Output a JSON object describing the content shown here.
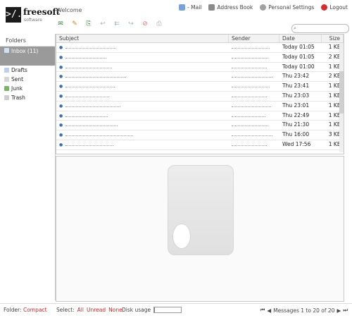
{
  "header": {
    "logo_mark": ">/.",
    "brand": "freesoft",
    "brand_sub": "software",
    "welcome": "Welcome",
    "nav": [
      {
        "label": "- Mail",
        "icon": "mail-icon"
      },
      {
        "label": "Address Book",
        "icon": "address-book-icon"
      },
      {
        "label": "Personal Settings",
        "icon": "settings-icon"
      },
      {
        "label": "Logout",
        "icon": "logout-icon"
      }
    ],
    "toolbar": [
      {
        "icon": "compose-icon",
        "glyph": "✉"
      },
      {
        "icon": "edit-icon",
        "glyph": "✎"
      },
      {
        "icon": "attachment-icon",
        "glyph": "⎘"
      },
      {
        "icon": "reply-icon",
        "glyph": "↩"
      },
      {
        "icon": "reply-all-icon",
        "glyph": "⇇"
      },
      {
        "icon": "forward-icon",
        "glyph": "↪"
      },
      {
        "icon": "delete-icon",
        "glyph": "⊘"
      },
      {
        "icon": "print-icon",
        "glyph": "⎙"
      }
    ],
    "search_placeholder": ""
  },
  "folders": {
    "heading": "Folders",
    "items": [
      {
        "label": "Inbox (11)",
        "icon": "inbox-icon",
        "selected": true
      },
      {
        "label": "Drafts",
        "icon": "drafts-icon"
      },
      {
        "label": "Sent",
        "icon": "sent-icon"
      },
      {
        "label": "Junk",
        "icon": "junk-icon"
      },
      {
        "label": "Trash",
        "icon": "trash-icon"
      }
    ]
  },
  "messages": {
    "columns": [
      "Subject",
      "Sender",
      "Date",
      "Size"
    ],
    "rows": [
      {
        "date": "Today 01:05",
        "size": "1 KB"
      },
      {
        "date": "Today 01:05",
        "size": "2 KB"
      },
      {
        "date": "Today 01:00",
        "size": "1 KB"
      },
      {
        "date": "Thu 23:42",
        "size": "2 KB"
      },
      {
        "date": "Thu 23:41",
        "size": "1 KB"
      },
      {
        "date": "Thu 23:03",
        "size": "1 KB"
      },
      {
        "date": "Thu 23:01",
        "size": "1 KB"
      },
      {
        "date": "Thu 22:49",
        "size": "1 KB"
      },
      {
        "date": "Thu 21:30",
        "size": "1 KB"
      },
      {
        "date": "Thu 16:00",
        "size": "3 KB"
      },
      {
        "date": "Wed 17:56",
        "size": "1 KB"
      }
    ]
  },
  "footer": {
    "folder_label": "Folder:",
    "folder_action": "Compact",
    "select_label": "Select:",
    "select_all": "All",
    "select_unread": "Unread",
    "select_none": "None",
    "disk_label": "Disk usage",
    "disk_fraction": 0.03,
    "page_info": "Messages 1 to 20 of 20"
  }
}
